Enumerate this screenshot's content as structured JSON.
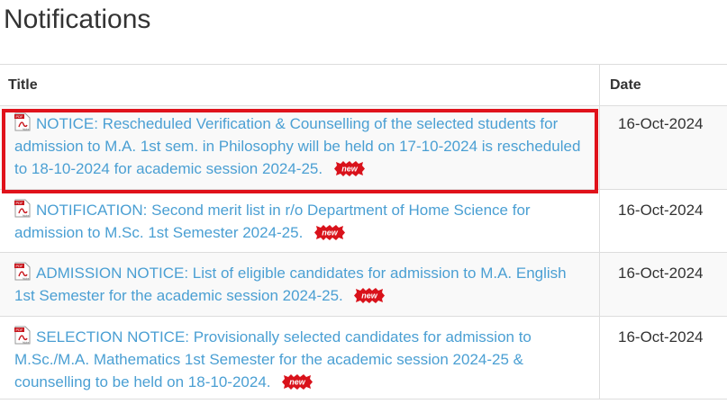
{
  "page": {
    "title": "Notifications"
  },
  "table": {
    "headers": {
      "title": "Title",
      "date": "Date"
    },
    "rows": [
      {
        "icon": "pdf-icon",
        "text": "NOTICE: Rescheduled Verification & Counselling of the selected students for admission to M.A. 1st sem. in Philosophy will be held on 17-10-2024 is rescheduled to 18-10-2024 for academic session 2024-25.",
        "badge": "new",
        "date": "16-Oct-2024",
        "highlighted": true
      },
      {
        "icon": "pdf-icon",
        "text": "NOTIFICATION: Second merit list in r/o Department of Home Science for admission to M.Sc. 1st Semester 2024-25.",
        "badge": "new",
        "date": "16-Oct-2024",
        "highlighted": false
      },
      {
        "icon": "pdf-icon",
        "text": "ADMISSION NOTICE: List of eligible candidates for admission to M.A. English 1st Semester for the academic session 2024-25.",
        "badge": "new",
        "date": "16-Oct-2024",
        "highlighted": false
      },
      {
        "icon": "pdf-icon",
        "text": "SELECTION NOTICE: Provisionally selected candidates for admission to M.Sc./M.A. Mathematics 1st Semester for the academic session 2024-25 & counselling to be held on 18-10-2024.",
        "badge": "new",
        "date": "16-Oct-2024",
        "highlighted": false
      }
    ]
  },
  "colors": {
    "link": "#4a9fd3",
    "highlight_border": "#e0121b",
    "badge": "#d9121b",
    "row_stripe": "#f9f9f9",
    "border": "#dddddd"
  }
}
